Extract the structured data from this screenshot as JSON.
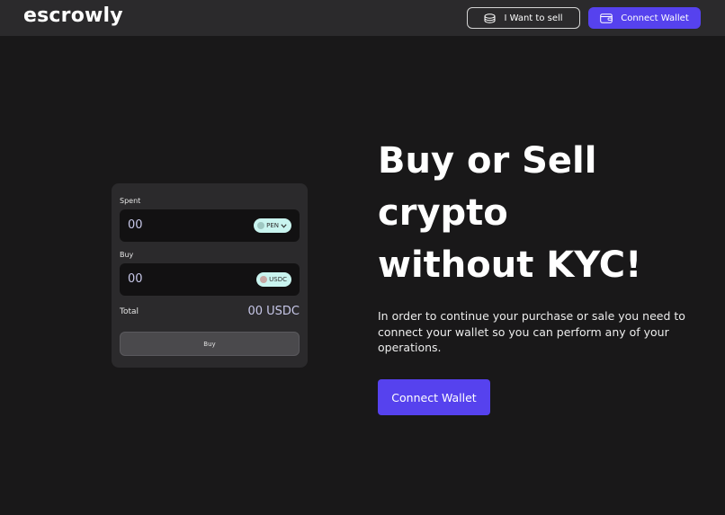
{
  "brand": {
    "logo_text": "escrowly"
  },
  "nav": {
    "sell_label": "I Want to sell",
    "sell_icon": "coin-stack-icon",
    "connect_label": "Connect Wallet",
    "connect_icon": "wallet-icon"
  },
  "widget": {
    "spent_label": "Spent",
    "spent_value": "00",
    "spent_currency": "PEN",
    "buy_label": "Buy",
    "buy_value": "00",
    "buy_currency": "USDC",
    "total_label": "Total",
    "total_value": "00 USDC",
    "buy_button_label": "Buy"
  },
  "hero": {
    "title_lines": [
      "Buy or Sell",
      "crypto",
      "without KYC!"
    ],
    "description": "In order to continue your purchase or sale you need to connect your wallet so you can perform any of your operations.",
    "cta_label": "Connect Wallet"
  },
  "colors": {
    "accent": "#5642ee",
    "background": "#191819",
    "surface": "#2b2a2c",
    "token_pill": "#c9f4ef"
  }
}
